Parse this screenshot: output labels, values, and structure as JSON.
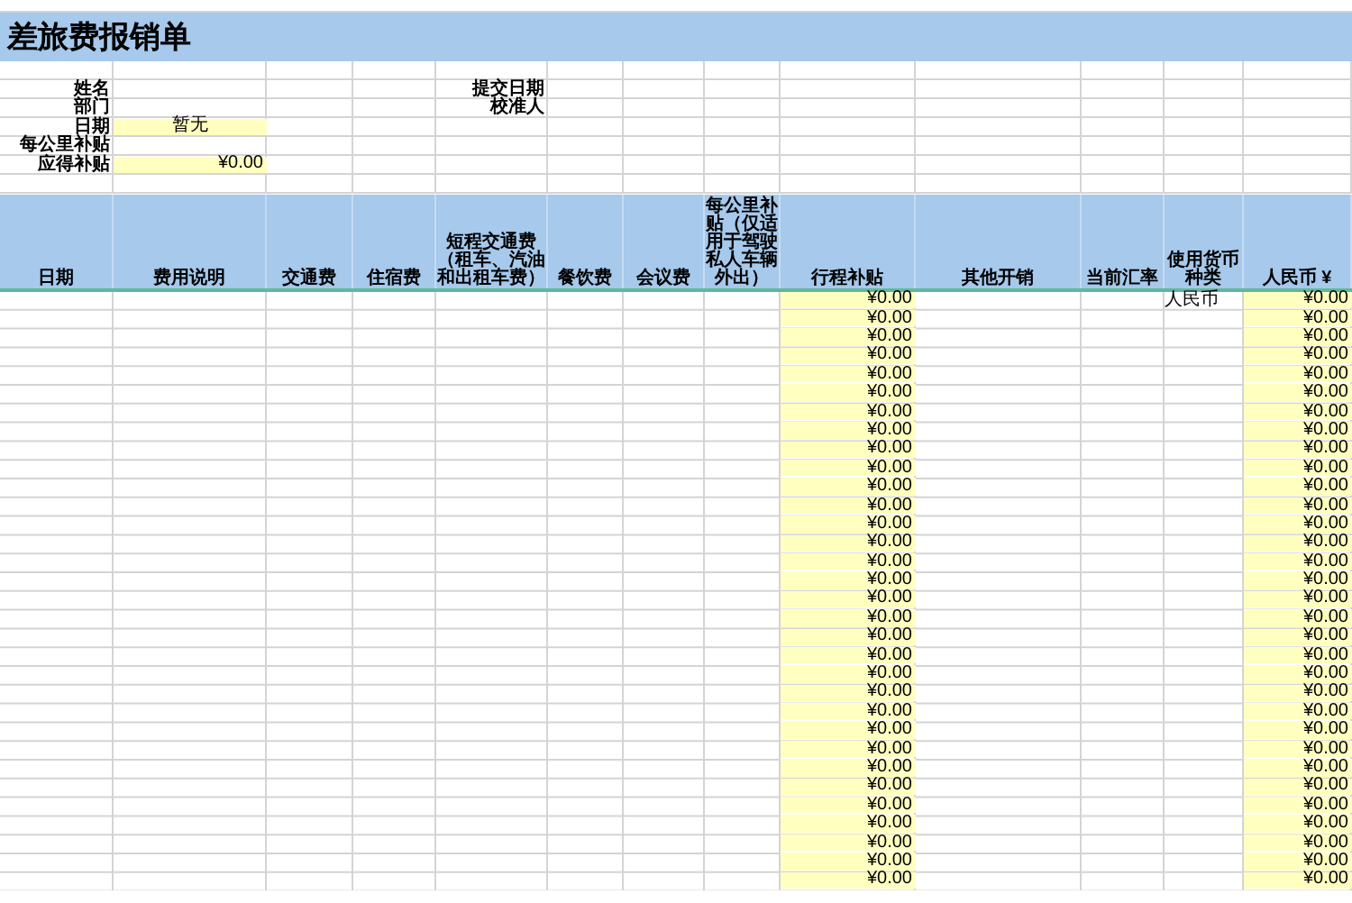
{
  "title": "差旅费报销单",
  "info": [
    {
      "label": "姓名",
      "right_label": "提交日期"
    },
    {
      "label": "部门",
      "right_label": "校准人"
    },
    {
      "label": "日期",
      "value": "暂无",
      "kind": "text"
    },
    {
      "label": "每公里补贴"
    },
    {
      "label": "应得补贴",
      "value": "¥0.00",
      "kind": "currency"
    }
  ],
  "columns": [
    "日期",
    "费用说明",
    "交通费",
    "住宿费",
    "短程交通费（租车、汽油和出租车费）",
    "餐饮费",
    "会议费",
    "每公里补贴（仅适用于驾驶私人车辆外出）",
    "行程补贴",
    "其他开销",
    "当前汇率",
    "使用货币种类",
    "人民币 ¥"
  ],
  "rows": [
    {
      "trip_allowance": "¥0.00",
      "currency": "人民币",
      "rmb": "¥0.00"
    },
    {
      "trip_allowance": "¥0.00",
      "rmb": "¥0.00"
    },
    {
      "trip_allowance": "¥0.00",
      "rmb": "¥0.00"
    },
    {
      "trip_allowance": "¥0.00",
      "rmb": "¥0.00"
    },
    {
      "trip_allowance": "¥0.00",
      "rmb": "¥0.00"
    },
    {
      "trip_allowance": "¥0.00",
      "rmb": "¥0.00"
    },
    {
      "trip_allowance": "¥0.00",
      "rmb": "¥0.00"
    },
    {
      "trip_allowance": "¥0.00",
      "rmb": "¥0.00"
    },
    {
      "trip_allowance": "¥0.00",
      "rmb": "¥0.00"
    },
    {
      "trip_allowance": "¥0.00",
      "rmb": "¥0.00"
    },
    {
      "trip_allowance": "¥0.00",
      "rmb": "¥0.00"
    },
    {
      "trip_allowance": "¥0.00",
      "rmb": "¥0.00"
    },
    {
      "trip_allowance": "¥0.00",
      "rmb": "¥0.00"
    },
    {
      "trip_allowance": "¥0.00",
      "rmb": "¥0.00"
    },
    {
      "trip_allowance": "¥0.00",
      "rmb": "¥0.00"
    },
    {
      "trip_allowance": "¥0.00",
      "rmb": "¥0.00"
    },
    {
      "trip_allowance": "¥0.00",
      "rmb": "¥0.00"
    },
    {
      "trip_allowance": "¥0.00",
      "rmb": "¥0.00"
    },
    {
      "trip_allowance": "¥0.00",
      "rmb": "¥0.00"
    },
    {
      "trip_allowance": "¥0.00",
      "rmb": "¥0.00"
    },
    {
      "trip_allowance": "¥0.00",
      "rmb": "¥0.00"
    },
    {
      "trip_allowance": "¥0.00",
      "rmb": "¥0.00"
    },
    {
      "trip_allowance": "¥0.00",
      "rmb": "¥0.00"
    },
    {
      "trip_allowance": "¥0.00",
      "rmb": "¥0.00"
    },
    {
      "trip_allowance": "¥0.00",
      "rmb": "¥0.00"
    },
    {
      "trip_allowance": "¥0.00",
      "rmb": "¥0.00"
    },
    {
      "trip_allowance": "¥0.00",
      "rmb": "¥0.00"
    },
    {
      "trip_allowance": "¥0.00",
      "rmb": "¥0.00"
    },
    {
      "trip_allowance": "¥0.00",
      "rmb": "¥0.00"
    },
    {
      "trip_allowance": "¥0.00",
      "rmb": "¥0.00"
    },
    {
      "trip_allowance": "¥0.00",
      "rmb": "¥0.00"
    },
    {
      "trip_allowance": "¥0.00",
      "rmb": "¥0.00"
    }
  ]
}
